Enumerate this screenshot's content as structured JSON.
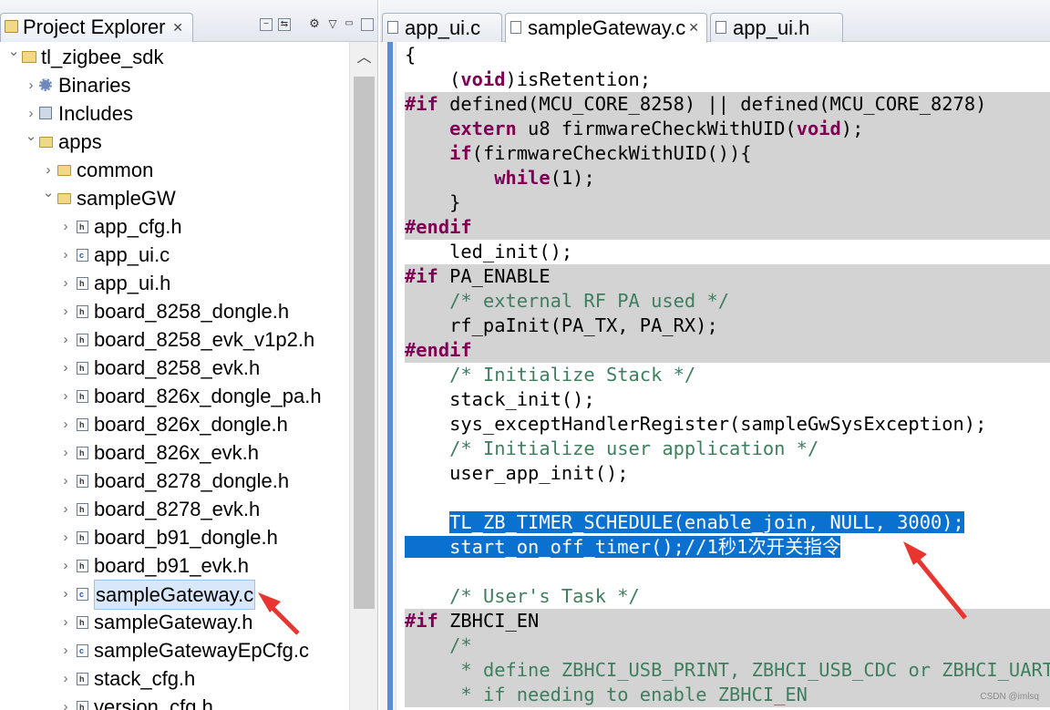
{
  "project_explorer": {
    "tab_title": "Project Explorer",
    "tree": [
      {
        "label": "tl_zigbee_sdk",
        "depth": 0,
        "state": "expanded",
        "icon": "project-icon"
      },
      {
        "label": "Binaries",
        "depth": 1,
        "state": "collapsed",
        "icon": "binaries-icon"
      },
      {
        "label": "Includes",
        "depth": 1,
        "state": "collapsed",
        "icon": "includes-icon"
      },
      {
        "label": "apps",
        "depth": 1,
        "state": "expanded",
        "icon": "folder-icon"
      },
      {
        "label": "common",
        "depth": 2,
        "state": "collapsed",
        "icon": "folder-icon"
      },
      {
        "label": "sampleGW",
        "depth": 2,
        "state": "expanded",
        "icon": "folder-icon"
      },
      {
        "label": "app_cfg.h",
        "depth": 3,
        "state": "collapsed",
        "icon": "header-file-icon"
      },
      {
        "label": "app_ui.c",
        "depth": 3,
        "state": "collapsed",
        "icon": "c-file-icon"
      },
      {
        "label": "app_ui.h",
        "depth": 3,
        "state": "collapsed",
        "icon": "header-file-icon"
      },
      {
        "label": "board_8258_dongle.h",
        "depth": 3,
        "state": "collapsed",
        "icon": "header-file-icon"
      },
      {
        "label": "board_8258_evk_v1p2.h",
        "depth": 3,
        "state": "collapsed",
        "icon": "header-file-icon"
      },
      {
        "label": "board_8258_evk.h",
        "depth": 3,
        "state": "collapsed",
        "icon": "header-file-icon"
      },
      {
        "label": "board_826x_dongle_pa.h",
        "depth": 3,
        "state": "collapsed",
        "icon": "header-file-icon"
      },
      {
        "label": "board_826x_dongle.h",
        "depth": 3,
        "state": "collapsed",
        "icon": "header-file-icon"
      },
      {
        "label": "board_826x_evk.h",
        "depth": 3,
        "state": "collapsed",
        "icon": "header-file-icon"
      },
      {
        "label": "board_8278_dongle.h",
        "depth": 3,
        "state": "collapsed",
        "icon": "header-file-icon"
      },
      {
        "label": "board_8278_evk.h",
        "depth": 3,
        "state": "collapsed",
        "icon": "header-file-icon"
      },
      {
        "label": "board_b91_dongle.h",
        "depth": 3,
        "state": "collapsed",
        "icon": "header-file-icon"
      },
      {
        "label": "board_b91_evk.h",
        "depth": 3,
        "state": "collapsed",
        "icon": "header-file-icon"
      },
      {
        "label": "sampleGateway.c",
        "depth": 3,
        "state": "collapsed",
        "icon": "c-file-icon",
        "selected": true
      },
      {
        "label": "sampleGateway.h",
        "depth": 3,
        "state": "collapsed",
        "icon": "header-file-icon"
      },
      {
        "label": "sampleGatewayEpCfg.c",
        "depth": 3,
        "state": "collapsed",
        "icon": "c-file-icon"
      },
      {
        "label": "stack_cfg.h",
        "depth": 3,
        "state": "collapsed",
        "icon": "header-file-icon"
      },
      {
        "label": "version_cfg.h",
        "depth": 3,
        "state": "collapsed",
        "icon": "header-file-icon"
      }
    ]
  },
  "editor": {
    "tabs": [
      {
        "label": "app_ui.c",
        "active": false
      },
      {
        "label": "sampleGateway.c",
        "active": true
      },
      {
        "label": "app_ui.h",
        "active": false
      }
    ],
    "lines": [
      {
        "inactive": false,
        "parts": [
          [
            "p",
            "{"
          ]
        ]
      },
      {
        "inactive": false,
        "parts": [
          [
            "p",
            "    ("
          ],
          [
            "kw",
            "void"
          ],
          [
            "p",
            ")isRetention;"
          ]
        ]
      },
      {
        "inactive": true,
        "parts": [
          [
            "pp",
            "#if"
          ],
          [
            "p",
            " defined(MCU_CORE_8258) || defined(MCU_CORE_8278)"
          ]
        ]
      },
      {
        "inactive": true,
        "parts": [
          [
            "p",
            "    "
          ],
          [
            "kw",
            "extern"
          ],
          [
            "p",
            " u8 firmwareCheckWithUID("
          ],
          [
            "kw",
            "void"
          ],
          [
            "p",
            ");"
          ]
        ]
      },
      {
        "inactive": true,
        "parts": [
          [
            "p",
            "    "
          ],
          [
            "kw",
            "if"
          ],
          [
            "p",
            "(firmwareCheckWithUID()){"
          ]
        ]
      },
      {
        "inactive": true,
        "parts": [
          [
            "p",
            "        "
          ],
          [
            "kw",
            "while"
          ],
          [
            "p",
            "(1);"
          ]
        ]
      },
      {
        "inactive": true,
        "parts": [
          [
            "p",
            "    }"
          ]
        ]
      },
      {
        "inactive": true,
        "parts": [
          [
            "pp",
            "#endif"
          ]
        ]
      },
      {
        "inactive": false,
        "parts": [
          [
            "p",
            "    led_init();"
          ]
        ]
      },
      {
        "inactive": true,
        "parts": [
          [
            "pp",
            "#if"
          ],
          [
            "p",
            " PA_ENABLE"
          ]
        ]
      },
      {
        "inactive": true,
        "parts": [
          [
            "p",
            "    "
          ],
          [
            "cm",
            "/* external RF PA used */"
          ]
        ]
      },
      {
        "inactive": true,
        "parts": [
          [
            "p",
            "    rf_paInit(PA_TX, PA_RX);"
          ]
        ]
      },
      {
        "inactive": true,
        "parts": [
          [
            "pp",
            "#endif"
          ]
        ]
      },
      {
        "inactive": false,
        "parts": [
          [
            "p",
            "    "
          ],
          [
            "cm",
            "/* Initialize Stack */"
          ]
        ]
      },
      {
        "inactive": false,
        "parts": [
          [
            "p",
            "    stack_init();"
          ]
        ]
      },
      {
        "inactive": false,
        "parts": [
          [
            "p",
            "    sys_exceptHandlerRegister(sampleGwSysException);"
          ]
        ]
      },
      {
        "inactive": false,
        "parts": [
          [
            "p",
            "    "
          ],
          [
            "cm",
            "/* Initialize user application */"
          ]
        ]
      },
      {
        "inactive": false,
        "parts": [
          [
            "p",
            "    user_app_init();"
          ]
        ]
      },
      {
        "inactive": false,
        "parts": [
          [
            "p",
            ""
          ]
        ]
      },
      {
        "inactive": false,
        "parts": [
          [
            "p",
            "    "
          ],
          [
            "hl",
            "TL_ZB_TIMER_SCHEDULE(enable_join, NULL, 3000);"
          ]
        ]
      },
      {
        "inactive": false,
        "parts": [
          [
            "hl",
            "    start_on_off_timer();//1秒1次开关指令"
          ]
        ]
      },
      {
        "inactive": false,
        "parts": [
          [
            "p",
            ""
          ]
        ]
      },
      {
        "inactive": false,
        "parts": [
          [
            "p",
            "    "
          ],
          [
            "cm",
            "/* User's Task */"
          ]
        ]
      },
      {
        "inactive": true,
        "parts": [
          [
            "pp",
            "#if"
          ],
          [
            "p",
            " ZBHCI_EN"
          ]
        ]
      },
      {
        "inactive": true,
        "parts": [
          [
            "p",
            "    "
          ],
          [
            "cm",
            "/*"
          ]
        ]
      },
      {
        "inactive": true,
        "parts": [
          [
            "p",
            "     "
          ],
          [
            "cm",
            "* define ZBHCI_USB_PRINT, ZBHCI_USB_CDC or ZBHCI_UART"
          ]
        ]
      },
      {
        "inactive": true,
        "parts": [
          [
            "p",
            "     "
          ],
          [
            "cm",
            "* if needing to enable ZBHCI_EN"
          ]
        ]
      }
    ]
  },
  "watermark": "CSDN @imlsq",
  "colors": {
    "accent": "#0a71d1",
    "keyword": "#7f0055",
    "comment": "#3f7f5f",
    "inactive_bg": "#d3d3d3",
    "annotation_arrow": "#e8352f"
  }
}
